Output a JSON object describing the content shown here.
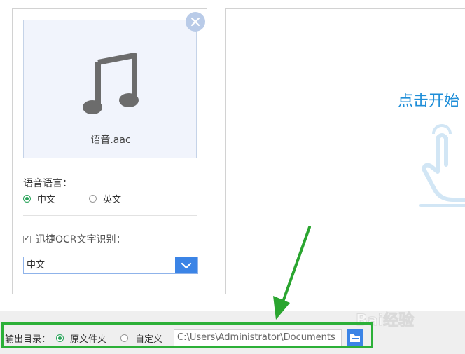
{
  "file": {
    "name": "语音.aac"
  },
  "language_section": {
    "label": "语音语言：",
    "options": [
      {
        "label": "中文",
        "selected": true
      },
      {
        "label": "英文",
        "selected": false
      }
    ]
  },
  "ocr": {
    "checkbox_label": "迅捷OCR文字识别：",
    "checked": true,
    "select_value": "中文"
  },
  "right_panel": {
    "start_text": "点击开始"
  },
  "output": {
    "label": "输出目录：",
    "options": [
      {
        "label": "原文件夹",
        "selected": true
      },
      {
        "label": "自定义",
        "selected": false
      }
    ],
    "path": "C:\\Users\\Administrator\\Documents"
  },
  "watermark": {
    "text": "Bai经验"
  },
  "colors": {
    "accent_blue": "#3b84e6",
    "text_blue": "#1f8ed8",
    "highlight_green": "#2cb038",
    "radio_green": "#2aa35a"
  }
}
